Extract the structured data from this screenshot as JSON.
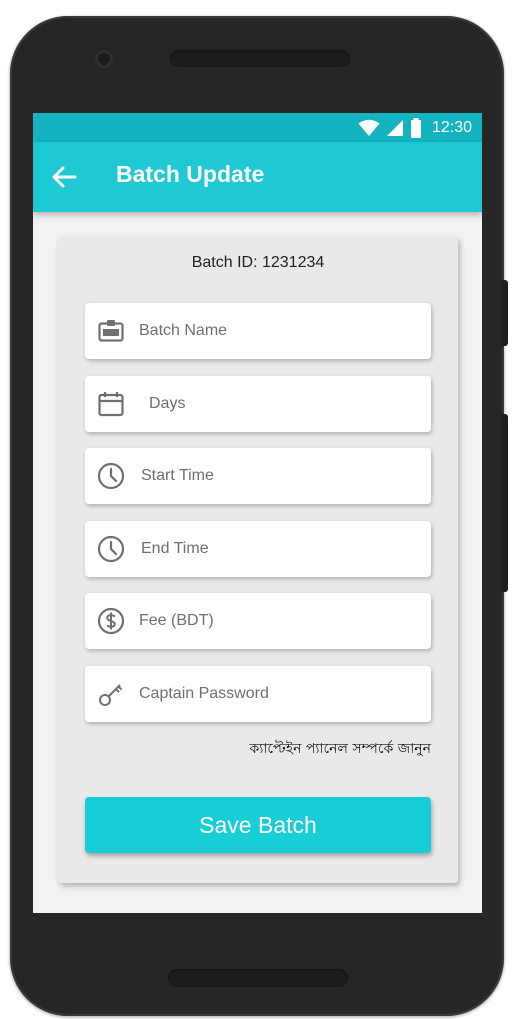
{
  "statusbar": {
    "time": "12:30",
    "icons": [
      "wifi-icon",
      "signal-icon",
      "battery-icon"
    ]
  },
  "appbar": {
    "title": "Batch Update",
    "back_icon": "arrow-back-icon"
  },
  "form": {
    "batch_id_text": "Batch ID: 1231234",
    "fields": [
      {
        "placeholder": "Batch Name",
        "value": "",
        "icon": "badge-icon"
      },
      {
        "placeholder": "Days",
        "value": "",
        "icon": "calendar-icon"
      },
      {
        "placeholder": "Start Time",
        "value": "",
        "icon": "clock-icon"
      },
      {
        "placeholder": "End Time",
        "value": "",
        "icon": "clock-icon"
      },
      {
        "placeholder": "Fee (BDT)",
        "value": "",
        "icon": "dollar-icon"
      },
      {
        "placeholder": "Captain Password",
        "value": "",
        "icon": "key-icon"
      }
    ],
    "captain_link": "ক্যাপ্টেইন প্যানেল সম্পর্কে জানুন",
    "save_label": "Save Batch"
  },
  "colors": {
    "statusbar": "#13b4bf",
    "appbar": "#1ec9d4",
    "button": "#18ccd8",
    "card": "#e9e9e9",
    "screen_bg": "#f2f2f2"
  }
}
